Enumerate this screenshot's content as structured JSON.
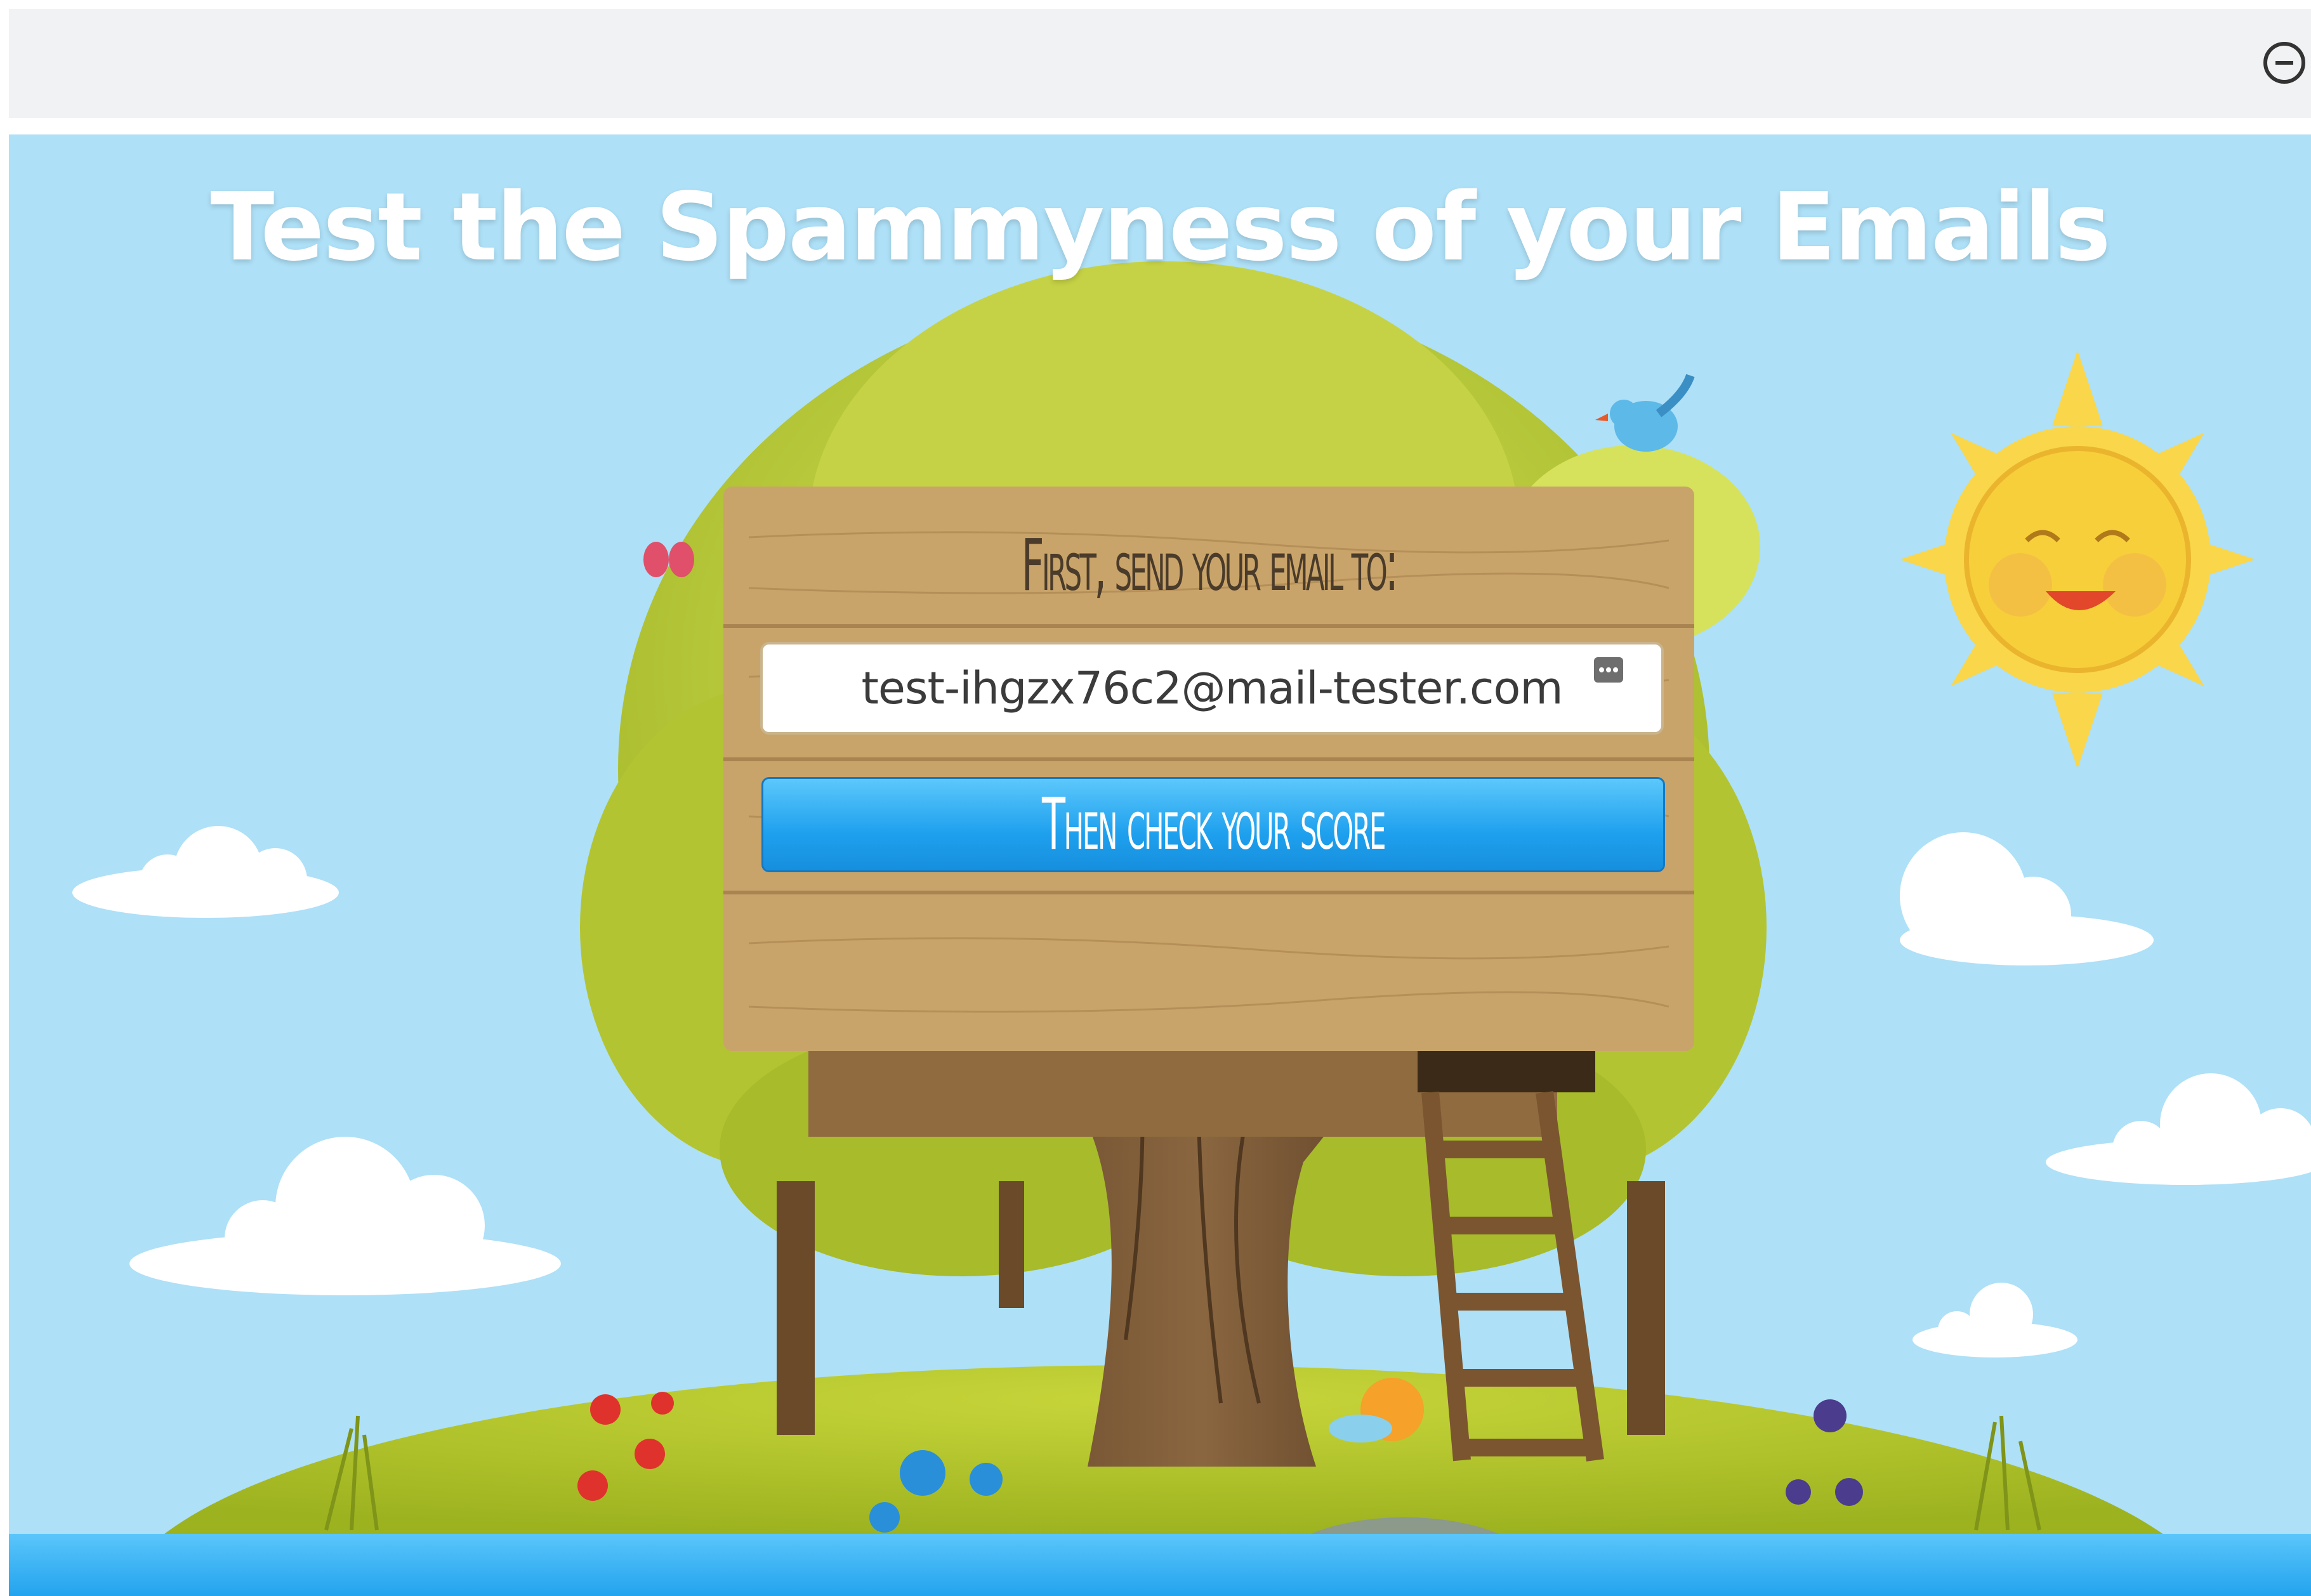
{
  "browser": {
    "zoom_icon": "zoom-out-icon"
  },
  "page": {
    "headline": "Test the Spammyness of your Emails",
    "sign": {
      "title": "First, send your email to:",
      "email_address": "test-ihgzx76c2@mail-tester.com",
      "copy_icon": "copy-icon",
      "button_label": "Then check your score"
    }
  },
  "colors": {
    "sky": "#aee0f7",
    "button": "#1ea0ee",
    "wood": "#c9a46a",
    "grass": "#b5c72c",
    "sun": "#f7cf3a"
  }
}
